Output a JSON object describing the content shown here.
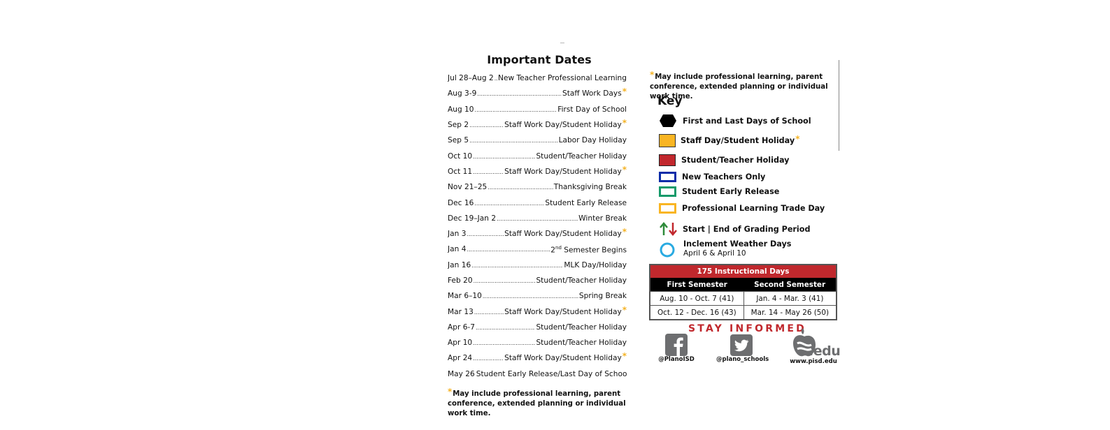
{
  "important_dates": {
    "title": "Important Dates",
    "items": [
      {
        "date": "Jul 28–Aug 2",
        "event": "New Teacher Professional Learning",
        "asterisk": false
      },
      {
        "date": "Aug 3-9",
        "event": "Staff Work Days",
        "asterisk": true
      },
      {
        "date": "Aug 10",
        "event": "First Day of School",
        "asterisk": false
      },
      {
        "date": "Sep 2",
        "event": "Staff Work Day/Student Holiday",
        "asterisk": true
      },
      {
        "date": "Sep 5",
        "event": "Labor Day Holiday",
        "asterisk": false
      },
      {
        "date": "Oct 10",
        "event": "Student/Teacher Holiday",
        "asterisk": false
      },
      {
        "date": "Oct 11",
        "event": "Staff Work Day/Student Holiday",
        "asterisk": true
      },
      {
        "date": "Nov 21–25",
        "event": "Thanksgiving Break",
        "asterisk": false
      },
      {
        "date": "Dec 16",
        "event": "Student Early Release",
        "asterisk": false
      },
      {
        "date": "Dec 19–Jan 2",
        "event": "Winter Break",
        "asterisk": false
      },
      {
        "date": "Jan 3",
        "event": "Staff Work Day/Student Holiday",
        "asterisk": true
      },
      {
        "date": "Jan 4",
        "event": "2nd Semester Begins",
        "asterisk": false
      },
      {
        "date": "Jan 16",
        "event": "MLK Day/Holiday",
        "asterisk": false
      },
      {
        "date": "Feb 20",
        "event": "Student/Teacher Holiday",
        "asterisk": false
      },
      {
        "date": "Mar 6–10",
        "event": "Spring Break",
        "asterisk": false
      },
      {
        "date": "Mar 13",
        "event": "Staff Work Day/Student Holiday",
        "asterisk": true
      },
      {
        "date": "Apr 6-7",
        "event": "Student/Teacher Holiday",
        "asterisk": false
      },
      {
        "date": "Apr 10",
        "event": "Student/Teacher Holiday",
        "asterisk": false
      },
      {
        "date": "Apr 24",
        "event": "Staff Work Day/Student Holiday",
        "asterisk": true
      },
      {
        "date": "May 26",
        "event": "Student Early Release/Last Day of School",
        "asterisk": false
      }
    ],
    "footnote_star": "*",
    "footnote": "May include professional learning, parent conference, extended planning or individual work time."
  },
  "note_top": {
    "star": "*",
    "text": "May include professional learning, parent conference, extended planning or individual work time."
  },
  "key": {
    "title": "Key",
    "items": [
      {
        "icon": "hexagon-icon",
        "label": "First and Last Days of School",
        "color": "#000000"
      },
      {
        "icon": "filled-square-icon",
        "label": "Staff Day/Student Holiday",
        "color": "#f9b523",
        "asterisk": "*"
      },
      {
        "icon": "filled-square-icon",
        "label": "Student/Teacher Holiday",
        "color": "#c1272d"
      },
      {
        "icon": "outline-square-icon",
        "label": "New Teachers Only",
        "color": "#0a2ca8"
      },
      {
        "icon": "outline-square-icon",
        "label": "Student Early Release",
        "color": "#159a6a"
      },
      {
        "icon": "outline-square-icon",
        "label": "Professional Learning Trade Day",
        "color": "#f9b523"
      },
      {
        "icon": "up-down-arrows-icon",
        "label": "Start | End of Grading Period",
        "colors": [
          "#2e8b3a",
          "#c1272d"
        ]
      },
      {
        "icon": "circle-icon",
        "label": "Inclement Weather Days",
        "sublabel": "April 6 & April 10",
        "color": "#29aae1"
      }
    ]
  },
  "instructional_days": {
    "title": "175 Instructional Days",
    "columns": [
      "First Semester",
      "Second Semester"
    ],
    "rows": [
      [
        "Aug. 10 - Oct. 7 (41)",
        "Jan. 4 - Mar. 3 (41)"
      ],
      [
        "Oct. 12 - Dec. 16 (43)",
        "Mar. 14 - May 26 (50)"
      ]
    ],
    "header_color": "#c0282d"
  },
  "stay_informed": {
    "title": "STAY INFORMED",
    "facebook": "@PlanoISD",
    "twitter": "@plano_schools",
    "web_logo_text": ".edu",
    "website": "www.pisd.edu"
  }
}
